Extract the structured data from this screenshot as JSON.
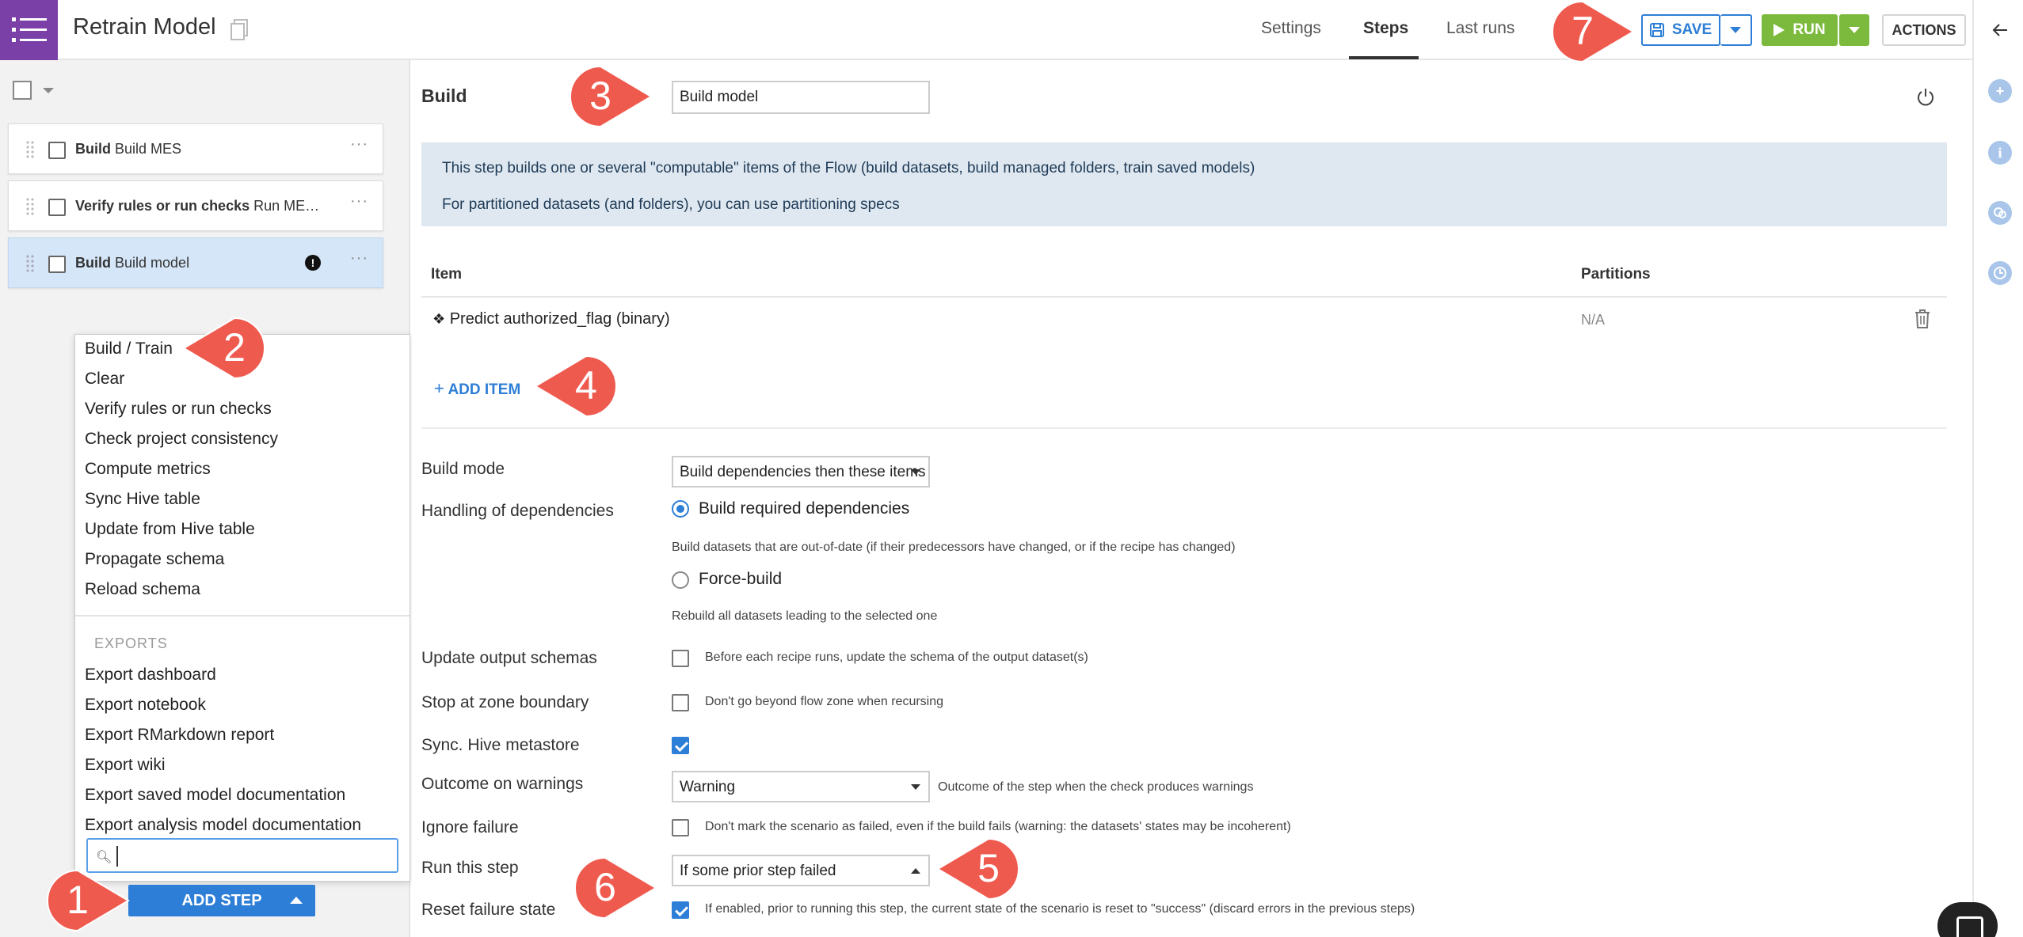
{
  "header": {
    "title": "Retrain Model",
    "tabs": [
      {
        "label": "Settings"
      },
      {
        "label": "Steps"
      },
      {
        "label": "Last runs"
      }
    ],
    "save_label": "SAVE",
    "run_label": "RUN",
    "actions_label": "ACTIONS"
  },
  "steps_list": [
    {
      "type": "Build",
      "name": "Build MES"
    },
    {
      "type": "Verify rules or run checks",
      "name": "Run ME…"
    },
    {
      "type": "Build",
      "name": "Build model"
    }
  ],
  "step_menu": {
    "items": [
      "Build / Train",
      "Clear",
      "Verify rules or run checks",
      "Check project consistency",
      "Compute metrics",
      "Sync Hive table",
      "Update from Hive table",
      "Propagate schema",
      "Reload schema"
    ],
    "exports_header": "EXPORTS",
    "export_items": [
      "Export dashboard",
      "Export notebook",
      "Export RMarkdown report",
      "Export wiki",
      "Export saved model documentation",
      "Export analysis model documentation"
    ],
    "search_value": ""
  },
  "add_step_label": "ADD STEP",
  "step_editor": {
    "section_title": "Build",
    "step_name": "Build model",
    "info_lines": [
      "This step builds one or several \"computable\" items of the Flow (build datasets, build managed folders, train saved models)",
      "For partitioned datasets (and folders), you can use partitioning specs"
    ],
    "table_headers": {
      "item": "Item",
      "partitions": "Partitions"
    },
    "items": [
      {
        "name": "Predict authorized_flag (binary)",
        "partitions": "N/A"
      }
    ],
    "add_item_label": "ADD ITEM",
    "build_mode": {
      "label": "Build mode",
      "value": "Build dependencies then these items"
    },
    "dependencies": {
      "label": "Handling of dependencies",
      "options": [
        {
          "label": "Build required dependencies",
          "help": "Build datasets that are out-of-date (if their predecessors have changed, or if the recipe has changed)",
          "selected": true
        },
        {
          "label": "Force-build",
          "help": "Rebuild all datasets leading to the selected one",
          "selected": false
        }
      ]
    },
    "update_schemas": {
      "label": "Update output schemas",
      "help": "Before each recipe runs, update the schema of the output dataset(s)",
      "checked": false
    },
    "stop_zone": {
      "label": "Stop at zone boundary",
      "help": "Don't go beyond flow zone when recursing",
      "checked": false
    },
    "sync_hive": {
      "label": "Sync. Hive metastore",
      "checked": true
    },
    "outcome_warnings": {
      "label": "Outcome on warnings",
      "value": "Warning",
      "help": "Outcome of the step when the check produces warnings"
    },
    "ignore_failure": {
      "label": "Ignore failure",
      "help": "Don't mark the scenario as failed, even if the build fails (warning: the datasets' states may be incoherent)",
      "checked": false
    },
    "run_this_step": {
      "label": "Run this step",
      "value": "If some prior step failed"
    },
    "reset_failure": {
      "label": "Reset failure state",
      "help": "If enabled, prior to running this step, the current state of the scenario is reset to \"success\" (discard errors in the previous steps)",
      "checked": true
    }
  },
  "callouts": [
    "1",
    "2",
    "3",
    "4",
    "5",
    "6",
    "7"
  ],
  "colors": {
    "brand_purple": "#7b3fa8",
    "accent_blue": "#2d7ed6",
    "run_green": "#7cba3d",
    "callout_red": "#ef5a4f",
    "info_bg": "#dfe8f0"
  }
}
